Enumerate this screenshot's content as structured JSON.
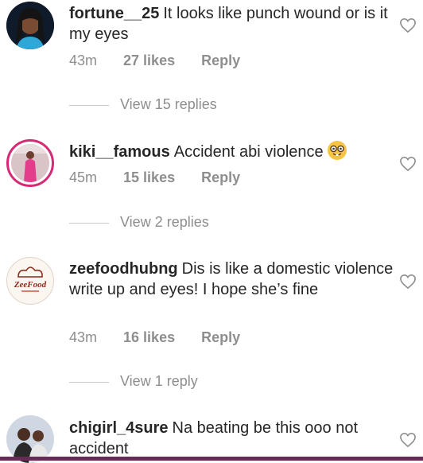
{
  "comments": [
    {
      "username": "fortune__25",
      "text": "It looks like punch wound or is it my eyes",
      "time": "43m",
      "likes": "27 likes",
      "reply_label": "Reply",
      "view_replies": "View 15 replies"
    },
    {
      "username": "kiki__famous",
      "text": "Accident abi violence",
      "emoji": "nerd-face-emoji",
      "time": "45m",
      "likes": "15 likes",
      "reply_label": "Reply",
      "view_replies": "View 2 replies"
    },
    {
      "username": "zeefoodhubng",
      "text": "Dis is like a domestic violence write up and eyes! I hope she’s fine",
      "avatar_logo_text": "ZeeFood",
      "time": "43m",
      "likes": "16 likes",
      "reply_label": "Reply",
      "view_replies": "View 1 reply"
    },
    {
      "username": "chigirl_4sure",
      "text": "Na beating be this ooo not accident"
    }
  ],
  "icons": {
    "like": "heart-outline-icon"
  },
  "colors": {
    "text": "#262626",
    "secondary": "#8e8e8e",
    "story_ring": "#d62976"
  }
}
